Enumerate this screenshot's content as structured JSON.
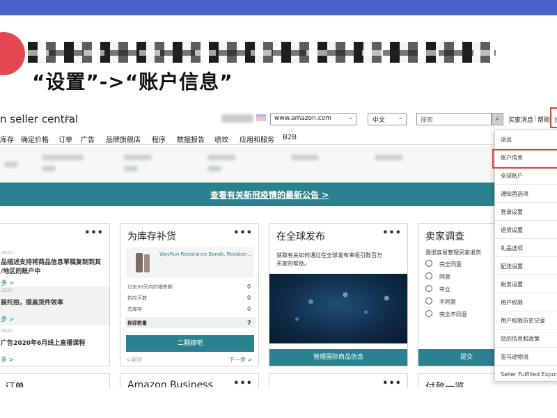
{
  "slide": {
    "heading": "“设置”->“账户信息”",
    "accent_colors": {
      "band": "#4a62c8",
      "circle": "#e4474f",
      "highlight": "#d9443a",
      "teal": "#2a8290"
    }
  },
  "header": {
    "logo": "n seller central",
    "flag_icon": "flag-icon",
    "marketplace": "www.amazon.com",
    "language": "中文",
    "search_placeholder": "搜索",
    "links": {
      "messages": "买家消息",
      "help": "帮助",
      "settings": "设"
    }
  },
  "nav": [
    "库存",
    "确定价格",
    "订单",
    "广告",
    "品牌旗舰店",
    "程序",
    "数据报告",
    "绩效",
    "应用和服务",
    "B2B"
  ],
  "banner": {
    "link": "查看有关新冠疫情的最新公告 >"
  },
  "cards": {
    "news": {
      "menu": "•••",
      "items": [
        {
          "date": "2020",
          "text": "品描述支持将商品信息草稿复制到其\n/地区的账户中",
          "more": "多 >"
        },
        {
          "date": "2020",
          "text": "装托拍，提高货件效率",
          "more": "多 >"
        },
        {
          "date": "2020",
          "text": "广告2020年6月线上直播课程",
          "more": "多 >"
        }
      ]
    },
    "restock": {
      "title": "为库存补货",
      "menu": "•••",
      "product": "WayRun Resistance Bands, Resistan...",
      "rows": [
        {
          "label": "过去30天内的销售额",
          "value": "0"
        },
        {
          "label": "供应天数",
          "value": "0"
        },
        {
          "label": "总库存",
          "value": "0"
        },
        {
          "label": "推荐数量",
          "value": "7"
        }
      ],
      "button": "二翻嫁吧",
      "prev": "<返回",
      "next": "下一步 >"
    },
    "global": {
      "title": "在全球发布",
      "menu": "•••",
      "desc": "获取有关如何通过在全球发布来吸引数百万\n买家的帮助。",
      "button": "管理国际商品信息"
    },
    "survey": {
      "title": "卖家调查",
      "menu": "•••",
      "question": "我很容易管理买家退货",
      "options": [
        "完全同意",
        "同意",
        "中立",
        "不同意",
        "完全不同意"
      ],
      "submit": "提交"
    }
  },
  "dropdown": {
    "items": [
      "退出",
      "账户信息",
      "全球账户",
      "通知首选项",
      "登录设置",
      "退货设置",
      "礼品选项",
      "配送设置",
      "税务设置",
      "用户权限",
      "用户权限历史记录",
      "您的信息和政策",
      "亚马逊物流",
      "Seller Fulfilled Expor"
    ],
    "highlighted_index": 1
  },
  "bottom_cards": [
    {
      "title": "订单",
      "menu": ""
    },
    {
      "title": "Amazon Business",
      "menu": "•••"
    },
    {
      "title": "",
      "menu": "•••"
    },
    {
      "title": "付款一览",
      "menu": ""
    }
  ]
}
